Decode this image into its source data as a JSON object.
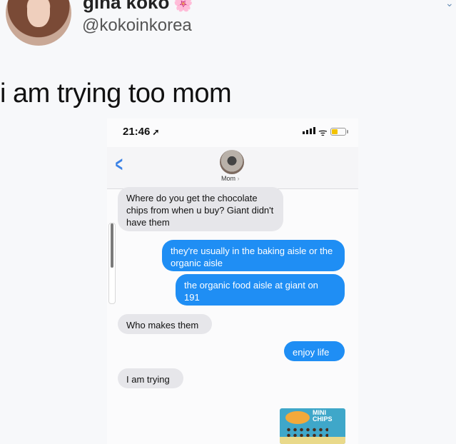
{
  "tweet": {
    "display_name": "gina koko",
    "name_emoji": "🌸",
    "handle": "@kokoinkorea",
    "text": "i am trying too mom"
  },
  "phone": {
    "status_time": "21:46",
    "status_location_icon": "location-arrow-icon",
    "contact_name": "Mom",
    "contact_chevron": "›",
    "back_icon": "chevron-left-icon"
  },
  "messages": [
    {
      "from": "them",
      "text": "Where do you get the chocolate chips from when u buy? Giant didn't have them"
    },
    {
      "from": "me",
      "text": "they're usually in the baking aisle or the organic aisle"
    },
    {
      "from": "me",
      "text": "the organic food aisle at giant on 191"
    },
    {
      "from": "them",
      "text": "Who makes them"
    },
    {
      "from": "me",
      "text": "enjoy life"
    },
    {
      "from": "them",
      "text": "I am trying"
    }
  ],
  "product_image": {
    "label_line1": "MINI",
    "label_line2": "CHIPS"
  },
  "colors": {
    "incoming_bubble": "#e6e6ea",
    "outgoing_bubble": "#1f8ef4",
    "accent_blue": "#3b82e6"
  }
}
